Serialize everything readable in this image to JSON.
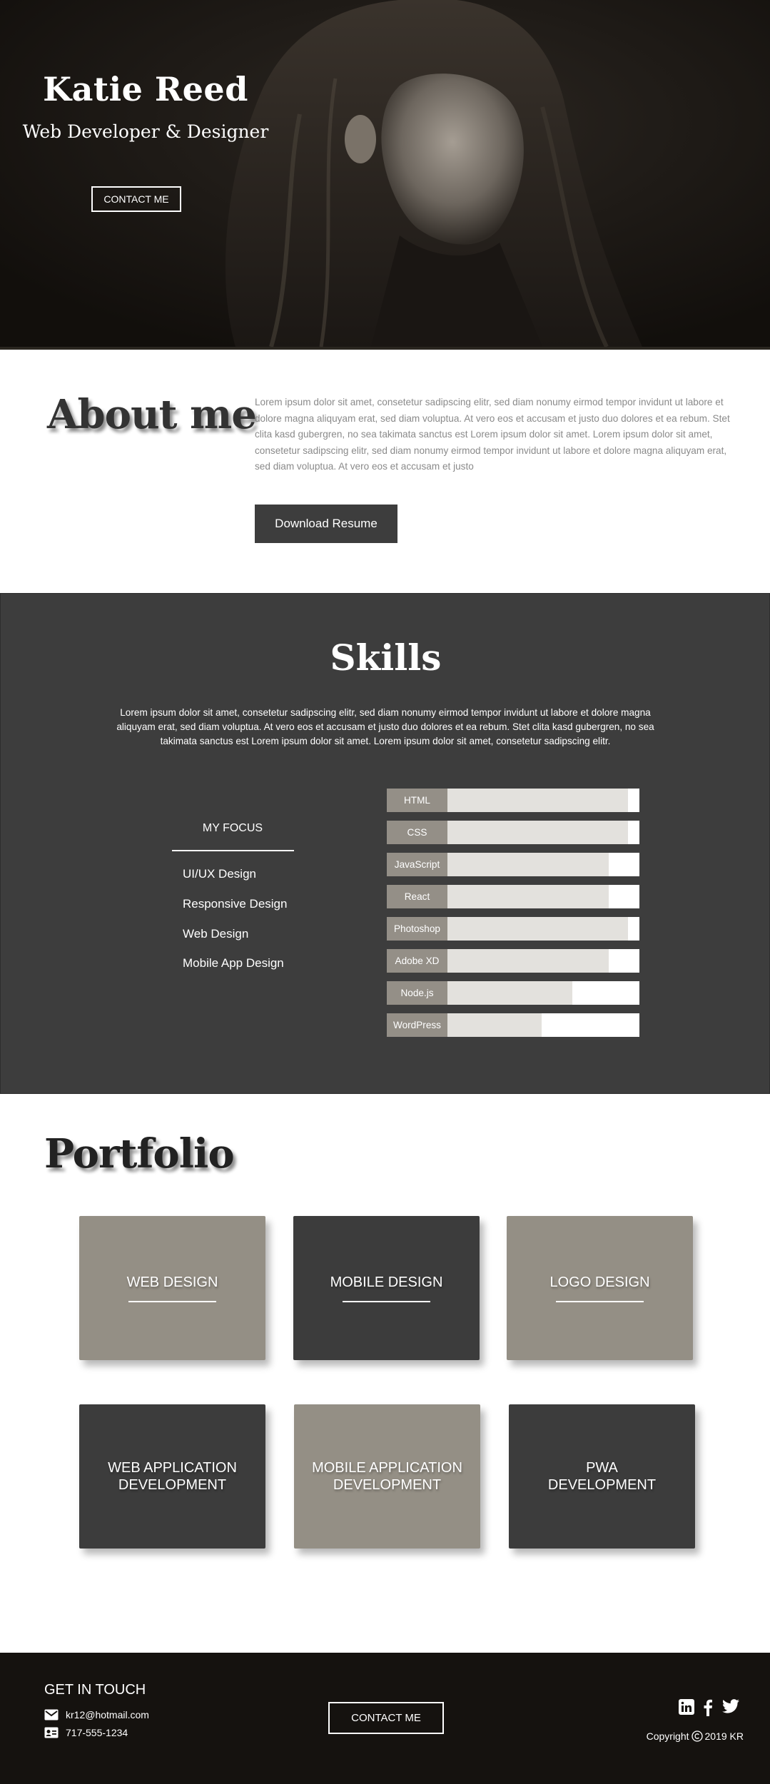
{
  "hero": {
    "name": "Katie Reed",
    "role": "Web Developer & Designer",
    "contact_button": "CONTACT ME"
  },
  "about": {
    "title": "About me",
    "text": "Lorem ipsum dolor sit amet, consetetur sadipscing elitr, sed diam nonumy eirmod tempor invidunt ut labore et dolore magna aliquyam erat, sed diam voluptua. At vero eos et accusam et justo duo dolores et ea rebum. Stet clita kasd gubergren, no sea takimata sanctus est Lorem ipsum dolor sit amet. Lorem ipsum dolor sit amet, consetetur sadipscing elitr, sed diam nonumy eirmod tempor invidunt ut labore et dolore magna aliquyam erat, sed diam voluptua. At vero eos et accusam et justo",
    "download_button": "Download Resume"
  },
  "skills": {
    "title": "Skills",
    "text": "Lorem ipsum dolor sit amet, consetetur sadipscing elitr, sed diam nonumy eirmod tempor invidunt ut labore et dolore magna aliquyam erat, sed diam voluptua. At vero eos et accusam et justo duo dolores et ea rebum. Stet clita kasd gubergren, no sea takimata sanctus est Lorem ipsum dolor sit amet. Lorem ipsum dolor sit amet, consetetur sadipscing elitr.",
    "focus_title": "MY FOCUS",
    "focus_items": [
      "UI/UX Design",
      "Responsive Design",
      "Web Design",
      "Mobile App Design"
    ],
    "bars": [
      {
        "label": "HTML",
        "level": 0.94
      },
      {
        "label": "CSS",
        "level": 0.94
      },
      {
        "label": "JavaScript",
        "level": 0.84
      },
      {
        "label": "React",
        "level": 0.84
      },
      {
        "label": "Photoshop",
        "level": 0.94
      },
      {
        "label": "Adobe XD",
        "level": 0.84
      },
      {
        "label": "Node.js",
        "level": 0.65
      },
      {
        "label": "WordPress",
        "level": 0.49
      }
    ]
  },
  "portfolio": {
    "title": "Portfolio",
    "cards": [
      {
        "label": "WEB DESIGN",
        "underline": true,
        "style": "tan"
      },
      {
        "label": "MOBILE DESIGN",
        "underline": true,
        "style": "dark"
      },
      {
        "label": "LOGO DESIGN",
        "underline": true,
        "style": "tan"
      },
      {
        "label": "WEB APPLICATION\nDEVELOPMENT",
        "underline": false,
        "style": "dark"
      },
      {
        "label": "MOBILE APPLICATION\nDEVELOPMENT",
        "underline": false,
        "style": "tan"
      },
      {
        "label": "PWA\nDEVELOPMENT",
        "underline": false,
        "style": "dark"
      }
    ]
  },
  "footer": {
    "title": "GET IN TOUCH",
    "email": "kr12@hotmail.com",
    "phone": "717-555-1234",
    "contact_button": "CONTACT ME",
    "social_icons": [
      "linkedin-icon",
      "facebook-icon",
      "twitter-icon"
    ],
    "copyright_prefix": "Copyright",
    "copyright_suffix": "2019 KR"
  },
  "colors": {
    "dark": "#3d3d3d",
    "tan": "#948f85",
    "footer": "#15120f",
    "bar_fill": "#e3e1dd"
  }
}
